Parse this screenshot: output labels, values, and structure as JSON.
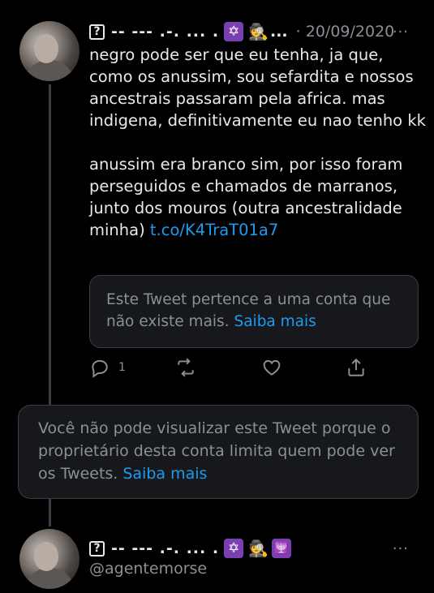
{
  "tweet1": {
    "name": "-- --- .-. ... .",
    "date": "· 20/09/2020",
    "more": "···",
    "paragraph1": "negro pode ser que eu tenha, ja que, como os anussim, sou sefardita e nossos ancestrais passaram pela africa. mas indigena, definitivamente eu nao tenho kk",
    "paragraph2_text": "anussim era branco sim, por isso foram perseguidos e chamados de marranos, junto dos mouros (outra ancestralidade minha) ",
    "paragraph2_link": "t.co/K4TraT01a7",
    "quote_text": "Este Tweet pertence a uma conta que não existe mais. ",
    "quote_link": "Saiba mais",
    "reply_count": "1"
  },
  "notice": {
    "text": "Você não pode visualizar este Tweet porque o proprietário desta conta limita quem pode ver os Tweets. ",
    "link": "Saiba mais"
  },
  "tweet2": {
    "name": "-- --- .-. ... .",
    "handle": "@agentemorse",
    "more": "···"
  },
  "icons": [
    "question-box-icon",
    "star-of-david-icon",
    "detective-icon",
    "menorah-icon",
    "reply-icon",
    "retweet-icon",
    "like-icon",
    "share-icon",
    "more-icon"
  ],
  "colors": {
    "background": "#000000",
    "text": "#e7e9ea",
    "muted": "#8b9096",
    "link": "#1d9bf0",
    "badge": "#7b3fb4"
  }
}
